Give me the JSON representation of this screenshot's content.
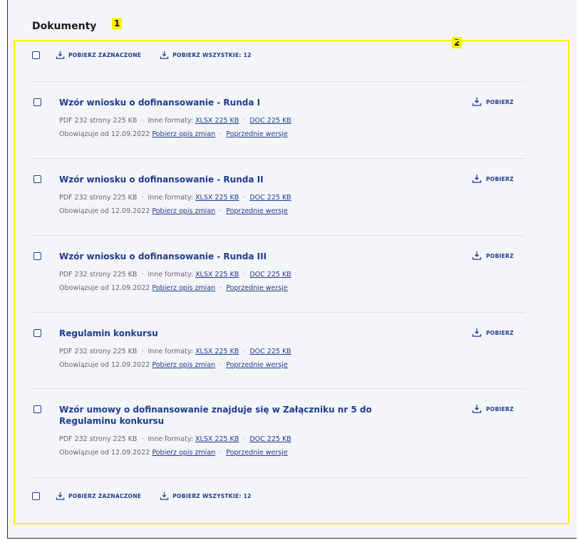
{
  "page": {
    "title": "Dokumenty",
    "badge_1": "1",
    "badge_2": "2"
  },
  "actions": {
    "download_selected": "POBIERZ ZAZNACZONE",
    "download_all": "POBIERZ WSZYSTKIE: 12"
  },
  "doc_labels": {
    "download": "POBIERZ",
    "other_formats": "Inne formaty:",
    "xlsx": "XLSX 225 KB",
    "doc": "DOC 225 KB",
    "valid_from": "Obowiązuje od 12.09.2022",
    "changes": "Pobierz opis zmian",
    "previous": "Poprzednie wersje"
  },
  "documents": [
    {
      "title": "Wzór wniosku o dofinansowanie - Runda I",
      "pdf": "PDF 232 strony 225 KB"
    },
    {
      "title": "Wzór wniosku o dofinansowanie - Runda II",
      "pdf": "PDF 232 strony 225 KB"
    },
    {
      "title": "Wzór wniosku o dofinansowanie - Runda III",
      "pdf": "PDF 232 strony 225 KB"
    },
    {
      "title": "Regulamin konkursu",
      "pdf": "PDF 232 strony 225 KB"
    },
    {
      "title": "Wzór umowy o dofinansowanie znajduje się w Załączniku nr 5 do Regulaminu konkursu",
      "pdf": "PDF 232 strony 225 KB"
    }
  ],
  "colors": {
    "accent": "#1f3b8f",
    "highlight": "#fff000",
    "background": "#f4f5f8"
  },
  "icons": {
    "download": "download-icon"
  }
}
